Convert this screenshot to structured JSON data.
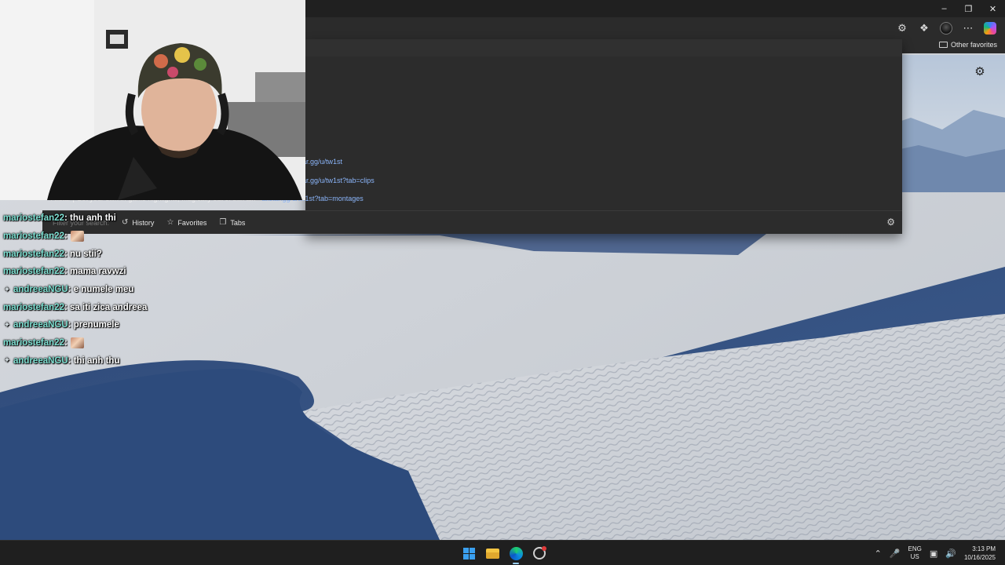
{
  "browser": {
    "favorites_bar": {
      "other_favorites": "Other favorites"
    },
    "toolbar_icons": [
      "extensions-icon",
      "collections-icon",
      "profile-avatar",
      "more-icon",
      "copilot-icon"
    ],
    "window_controls": [
      "minimize-icon",
      "restore-icon",
      "close-icon"
    ]
  },
  "omnibox": {
    "suggestions": [
      "ar.gg/u/tw1st",
      "ar.gg/u/tw1st?tab=clips"
    ],
    "main_suggestion": {
      "text": "Allstar | Get your own in-game highlights, magically out of thin air.",
      "separator": " - ",
      "link": "allstar.gg/u/tw1st?tab=montages"
    },
    "footer": {
      "filter_label": "Filter your search:",
      "history": "History",
      "favorites": "Favorites",
      "tabs": "Tabs"
    }
  },
  "chat": {
    "messages": [
      {
        "user": "mariostefan22",
        "text": "thu anh thi",
        "badge": false,
        "emote": false
      },
      {
        "user": "mariostefan22",
        "text": "",
        "badge": false,
        "emote": true
      },
      {
        "user": "mariostefan22",
        "text": "nu stii?",
        "badge": false,
        "emote": false
      },
      {
        "user": "mariostefan22",
        "text": "mama ravwzi",
        "badge": false,
        "emote": false
      },
      {
        "user": "andreeaNGU",
        "text": "e numele meu",
        "badge": true,
        "emote": false
      },
      {
        "user": "mariostefan22",
        "text": "sa iti zica andreea",
        "badge": false,
        "emote": false
      },
      {
        "user": "andreeaNGU",
        "text": "prenumele",
        "badge": true,
        "emote": false
      },
      {
        "user": "mariostefan22",
        "text": "",
        "badge": false,
        "emote": true
      },
      {
        "user": "andreeaNGU",
        "text": "thi anh thu",
        "badge": true,
        "emote": false
      }
    ]
  },
  "taskbar": {
    "apps": [
      "windows-start-icon",
      "file-explorer-icon",
      "edge-icon",
      "app-icon"
    ],
    "language": {
      "lang": "ENG",
      "region": "US"
    },
    "time": "3:13 PM",
    "date": "10/16/2025"
  }
}
